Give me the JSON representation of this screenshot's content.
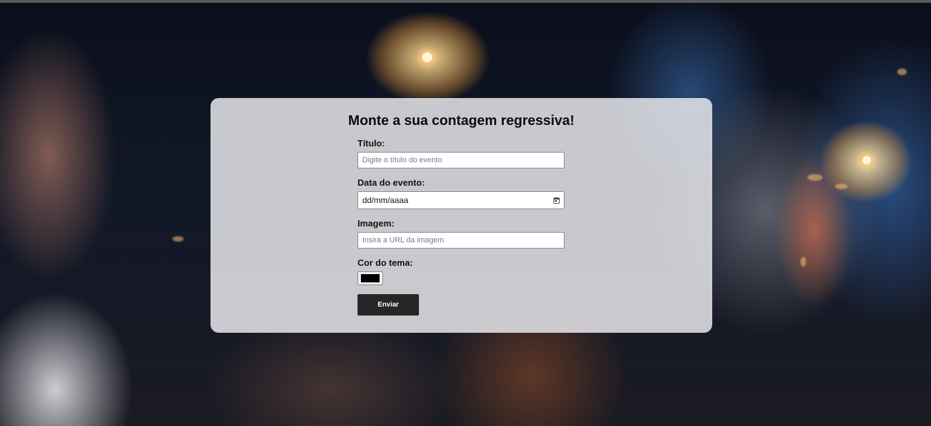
{
  "form": {
    "title": "Monte a sua contagem regressiva!",
    "title_field": {
      "label": "Título:",
      "placeholder": "Digite o título do evento",
      "value": ""
    },
    "date_field": {
      "label": "Data do evento:",
      "display": "dd/mm/aaaa"
    },
    "image_field": {
      "label": "Imagem:",
      "placeholder": "Insira a URL da imagem",
      "value": ""
    },
    "color_field": {
      "label": "Cor do tema:",
      "value": "#000000"
    },
    "submit_label": "Enviar"
  },
  "icons": {
    "date_picker": "calendar-icon"
  },
  "colors": {
    "card_background": "#e7e7eb",
    "button_background": "#262626",
    "button_text": "#ffffff"
  }
}
